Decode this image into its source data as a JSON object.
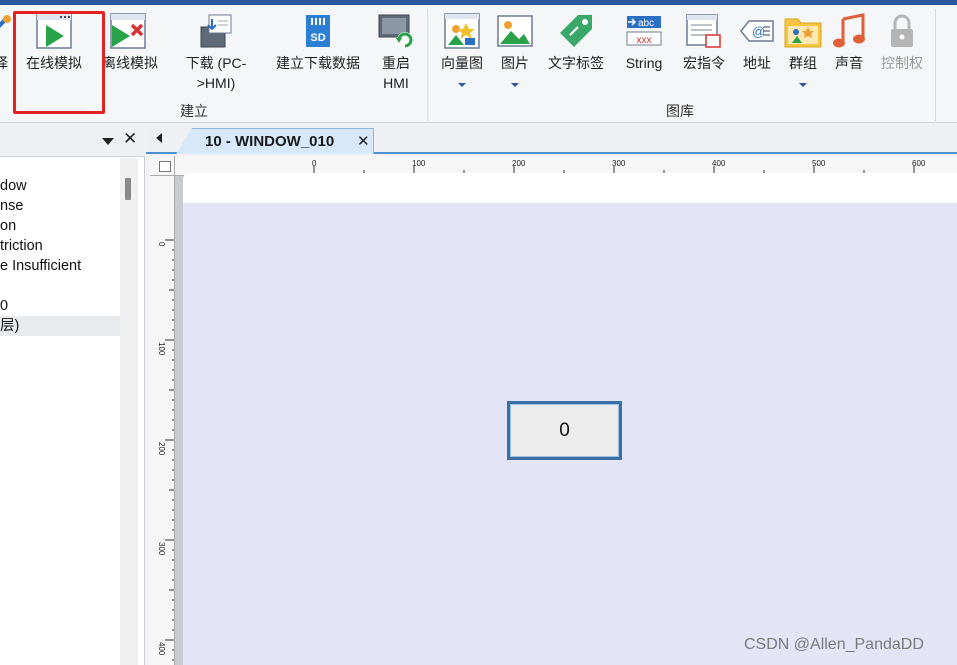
{
  "ribbon": {
    "items": [
      {
        "id": "partial-left",
        "label": "择",
        "icon": "wrench-icon"
      },
      {
        "id": "online-sim",
        "label": "在线模拟",
        "icon": "play-window-icon"
      },
      {
        "id": "offline-sim",
        "label": "离线模拟",
        "icon": "play-window-x-icon"
      },
      {
        "id": "download",
        "label": "下载 (PC->HMI)",
        "label_line1": "下载 (PC-",
        "label_line2": ">HMI)",
        "icon": "download-icon"
      },
      {
        "id": "build-download-data",
        "label": "建立下载数据",
        "icon": "sd-card-icon"
      },
      {
        "id": "restart-hmi",
        "label": "重启 HMI",
        "label_line1": "重启",
        "label_line2": "HMI",
        "icon": "monitor-refresh-icon"
      },
      {
        "id": "vector-graphics",
        "label": "向量图",
        "icon": "vector-image-icon"
      },
      {
        "id": "picture",
        "label": "图片",
        "icon": "picture-icon"
      },
      {
        "id": "text-tag",
        "label": "文字标签",
        "icon": "tag-icon"
      },
      {
        "id": "string",
        "label": "String",
        "icon": "abc-string-icon"
      },
      {
        "id": "macro",
        "label": "宏指令",
        "icon": "macro-icon"
      },
      {
        "id": "address",
        "label": "地址",
        "icon": "at-tag-icon"
      },
      {
        "id": "group",
        "label": "群组",
        "icon": "group-folder-icon"
      },
      {
        "id": "sound",
        "label": "声音",
        "icon": "music-note-icon"
      },
      {
        "id": "control",
        "label": "控制权",
        "icon": "lock-icon"
      }
    ],
    "groups": {
      "build": "建立",
      "library": "图库"
    }
  },
  "left_panel": {
    "rows": [
      "dow",
      "nse",
      "on",
      "triction",
      "e Insufficient",
      "",
      "0",
      "层)"
    ],
    "selected_index": 7
  },
  "editor": {
    "tab_title": "10 - WINDOW_010",
    "hruler_labels": [
      "0",
      "100",
      "200",
      "300",
      "400",
      "500",
      "600"
    ],
    "vruler_labels": [
      "0",
      "100",
      "200",
      "300",
      "400"
    ],
    "button_value": "0"
  },
  "watermark": "CSDN @Allen_PandaDD"
}
